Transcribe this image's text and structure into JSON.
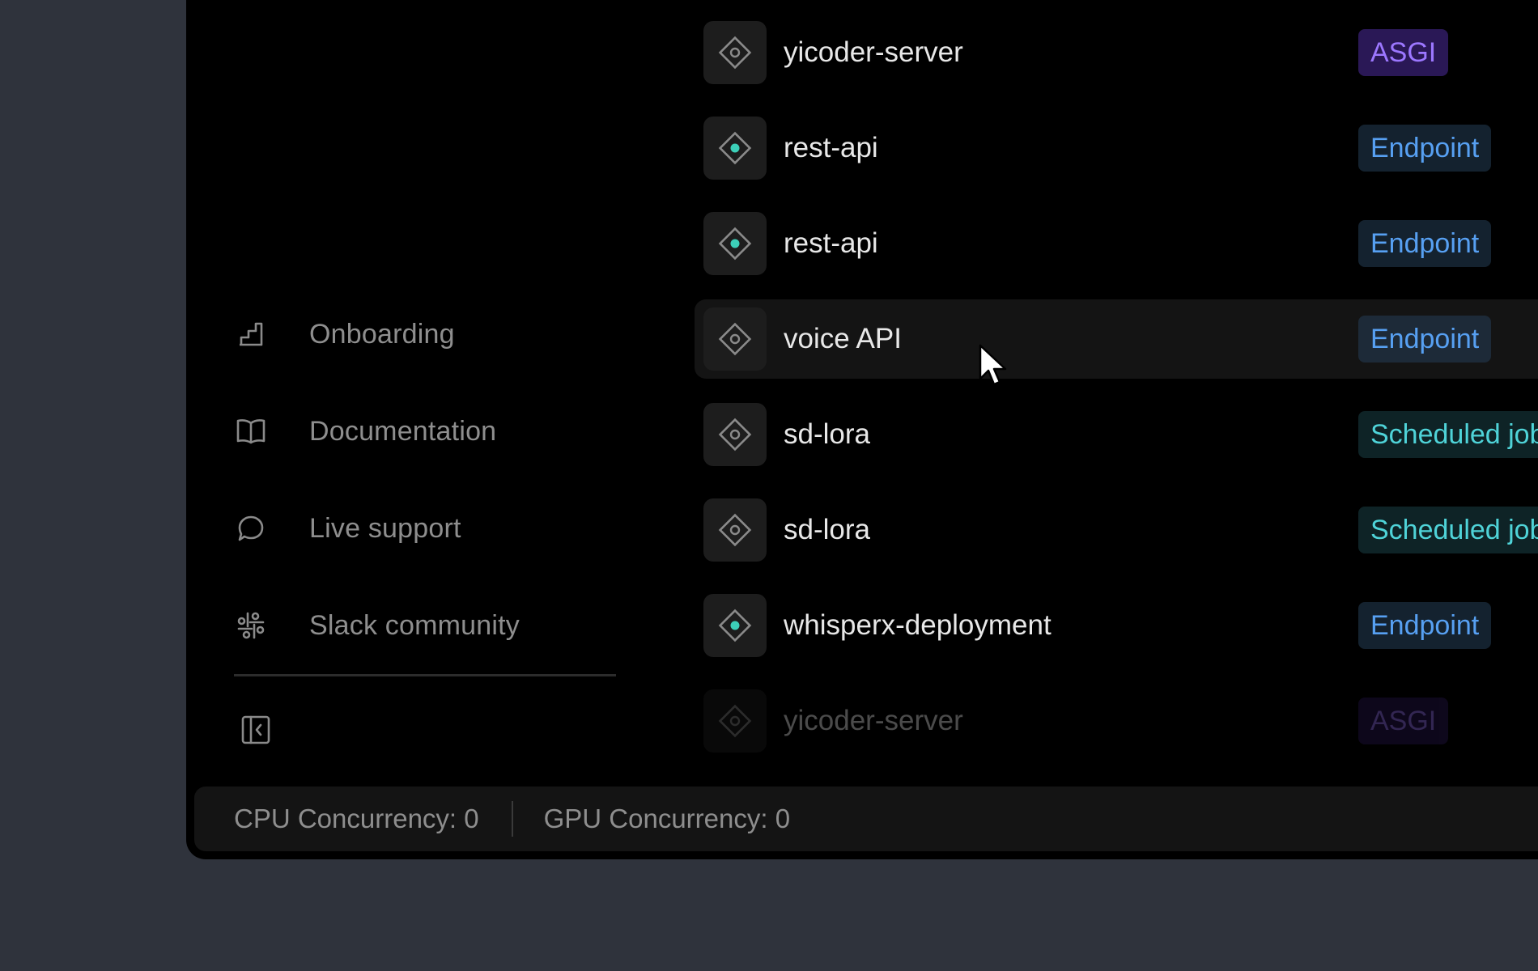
{
  "sidebar": {
    "items": [
      {
        "label": "Onboarding",
        "icon": "stairs-icon"
      },
      {
        "label": "Documentation",
        "icon": "book-icon"
      },
      {
        "label": "Live support",
        "icon": "chat-bubble-icon"
      },
      {
        "label": "Slack community",
        "icon": "slack-icon"
      }
    ],
    "collapse_icon": "sidebar-collapse-icon"
  },
  "apps": [
    {
      "name": "yicoder-server",
      "type": "ASGI",
      "status": "inactive"
    },
    {
      "name": "rest-api",
      "type": "Endpoint",
      "status": "active"
    },
    {
      "name": "rest-api",
      "type": "Endpoint",
      "status": "active"
    },
    {
      "name": "voice API",
      "type": "Endpoint",
      "status": "inactive"
    },
    {
      "name": "sd-lora",
      "type": "Scheduled job",
      "status": "inactive"
    },
    {
      "name": "sd-lora",
      "type": "Scheduled job",
      "status": "inactive"
    },
    {
      "name": "whisperx-deployment",
      "type": "Endpoint",
      "status": "active"
    },
    {
      "name": "yicoder-server",
      "type": "ASGI",
      "status": "inactive"
    }
  ],
  "status_bar": {
    "cpu": "CPU Concurrency: 0",
    "gpu": "GPU Concurrency: 0"
  },
  "colors": {
    "active_dot": "#3ccfb8",
    "asgi": "#9c77ff",
    "endpoint": "#57a0f2",
    "scheduled_job": "#4fd3d8",
    "background": "#2f333c"
  }
}
